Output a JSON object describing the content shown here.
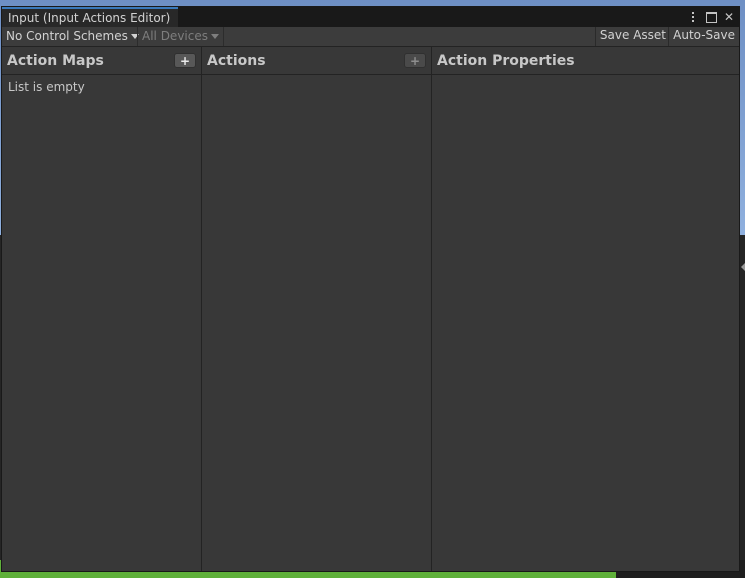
{
  "window": {
    "tab_title": "Input (Input Actions Editor)"
  },
  "toolbar": {
    "control_schemes": "No Control Schemes",
    "devices": "All Devices",
    "save_asset": "Save Asset",
    "auto_save": "Auto-Save"
  },
  "panes": {
    "action_maps": {
      "title": "Action Maps",
      "add_label": "+",
      "empty_text": "List is empty"
    },
    "actions": {
      "title": "Actions",
      "add_label": "+"
    },
    "action_properties": {
      "title": "Action Properties"
    }
  },
  "icons": {
    "close": "✕",
    "maximize": "maximize-icon",
    "menu": "kebab-menu-icon"
  },
  "colors": {
    "tab_accent": "#3a79bb",
    "panel_bg": "#383838",
    "titlebar_bg": "#191919"
  }
}
